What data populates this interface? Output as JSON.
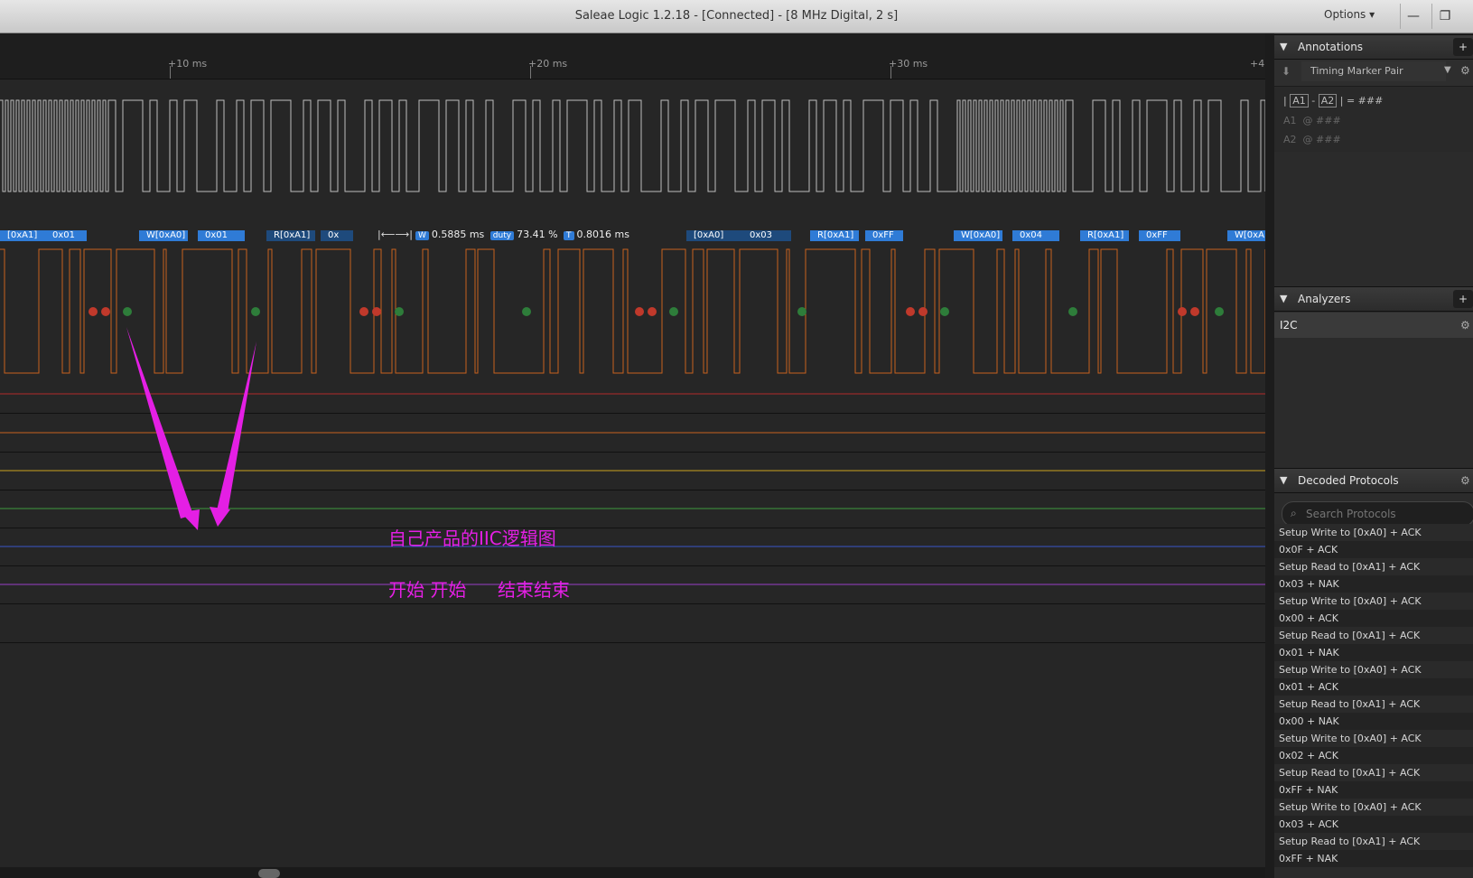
{
  "window": {
    "title": "Saleae Logic 1.2.18 - [Connected] - [8 MHz Digital, 2 s]",
    "options_label": "Options ▾",
    "minimize": "—",
    "restore": "❐"
  },
  "ruler": {
    "ticks": [
      "+10 ms",
      "+20 ms",
      "+30 ms",
      "+4"
    ]
  },
  "decode_bubbles": [
    "[0xA1]",
    "0x01",
    "W[0xA0]",
    "0x01",
    "R[0xA1]",
    "0x",
    "[0xA0]",
    "0x03",
    "R[0xA1]",
    "0xFF",
    "W[0xA0]",
    "0x04",
    "R[0xA1]",
    "0xFF",
    "W[0xA"
  ],
  "measurements": {
    "width_badge": "W",
    "width_value": "0.5885 ms",
    "duty_badge": "duty",
    "duty_value": "73.41 %",
    "period_badge": "T",
    "period_value": "0.8016 ms"
  },
  "overlay": {
    "caption": "自己产品的IIC逻辑图",
    "start_label": "开始 开始",
    "end_label": "结束结束"
  },
  "annotations": {
    "header": "Annotations",
    "add": "+",
    "marker_pair": "Timing Marker Pair",
    "diff_a1": "A1",
    "diff_a2": "A2",
    "diff_value": "= ###",
    "row_a1_label": "A1",
    "row_a1_value": "@ ###",
    "row_a2_label": "A2",
    "row_a2_value": "@ ###"
  },
  "analyzers": {
    "header": "Analyzers",
    "add": "+",
    "items": [
      "I2C"
    ]
  },
  "decoded": {
    "header": "Decoded Protocols",
    "search_placeholder": "Search Protocols",
    "rows": [
      "Setup Write to [0xA0] + ACK",
      "0x0F + ACK",
      "Setup Read to [0xA1] + ACK",
      "0x03 + NAK",
      "Setup Write to [0xA0] + ACK",
      "0x00 + ACK",
      "Setup Read to [0xA1] + ACK",
      "0x01 + NAK",
      "Setup Write to [0xA0] + ACK",
      "0x01 + ACK",
      "Setup Read to [0xA1] + ACK",
      "0x00 + NAK",
      "Setup Write to [0xA0] + ACK",
      "0x02 + ACK",
      "Setup Read to [0xA1] + ACK",
      "0xFF + NAK",
      "Setup Write to [0xA0] + ACK",
      "0x03 + ACK",
      "Setup Read to [0xA1] + ACK",
      "0xFF + NAK"
    ]
  },
  "colors": {
    "clock_trace": "#bdbdbd",
    "data_trace": "#c8611d",
    "bubble": "#2f7bd6",
    "bubble_dim": "#1e4a7c",
    "start_dot": "#2e7d3a",
    "stop_dot": "#c0392b",
    "annotation_pen": "#e41fe4",
    "ch2": "#b22a2a",
    "ch3": "#c8611d",
    "ch4": "#c9a21d",
    "ch5": "#3f9a3f",
    "ch6": "#3a56c8",
    "ch7": "#9b3fc8"
  }
}
